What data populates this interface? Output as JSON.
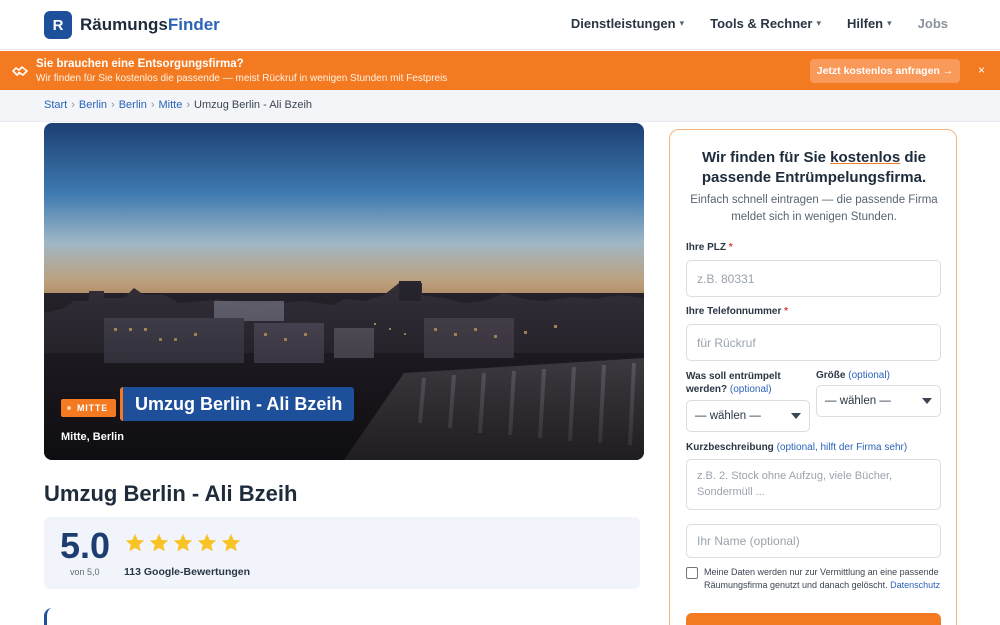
{
  "header": {
    "logo_letter": "R",
    "logo_part1": "Räumungs",
    "logo_part2": "Finder",
    "nav": [
      {
        "label": "Dienstleistungen",
        "icon": "chevron-down-icon"
      },
      {
        "label": "Tools & Rechner",
        "icon": "chevron-down-icon"
      },
      {
        "label": "Hilfen",
        "icon": "chevron-down-icon"
      },
      {
        "label": "Jobs"
      }
    ]
  },
  "banner": {
    "title": "Sie brauchen eine Entsorgungsfirma?",
    "subtitle": "Wir finden für Sie kostenlos die passende — meist Rückruf in wenigen Stunden mit Festpreis",
    "cta": "Jetzt kostenlos anfragen →",
    "close": "×",
    "color": "#f37a20"
  },
  "breadcrumb": {
    "items": [
      "Start",
      "Berlin",
      "Berlin",
      "Mitte"
    ],
    "current": "Umzug Berlin - Ali Bzeih",
    "sep": "›"
  },
  "hero": {
    "badge": "MITTE",
    "title": "Umzug Berlin - Ali Bzeih",
    "location": "Mitte, Berlin"
  },
  "page_title": "Umzug Berlin - Ali Bzeih",
  "rating": {
    "score": "5.0",
    "of": "von 5,0",
    "stars": 5,
    "count": "113 Google-Bewertungen",
    "star_color": "#f7c325"
  },
  "form": {
    "heading_pre": "Wir finden für Sie ",
    "heading_hl": "kostenlos",
    "heading_post": " die passende Entrümpelungsfirma.",
    "intro": "Einfach schnell eintragen — die passende Firma meldet sich in wenigen Stunden.",
    "plz_label": "Ihre PLZ",
    "plz_placeholder": "z.B. 80331",
    "phone_label": "Ihre Telefonnummer",
    "phone_placeholder": "für Rückruf",
    "required_mark": "*",
    "what_label": "Was soll entrümpelt werden?",
    "what_optional": "(optional)",
    "what_value": "— wählen —",
    "size_label": "Größe",
    "size_optional": "(optional)",
    "size_value": "— wählen —",
    "desc_label": "Kurzbeschreibung",
    "desc_optional": "(optional, hilft der Firma sehr)",
    "desc_placeholder": "z.B. 2. Stock ohne Aufzug, viele Bücher, Sondermüll ...",
    "name_placeholder": "Ihr Name (optional)",
    "consent_text": "Meine Daten werden nur zur Vermittlung an eine passende Räumungsfirma genutzt und danach gelöscht.",
    "consent_link": "Datenschutz"
  }
}
